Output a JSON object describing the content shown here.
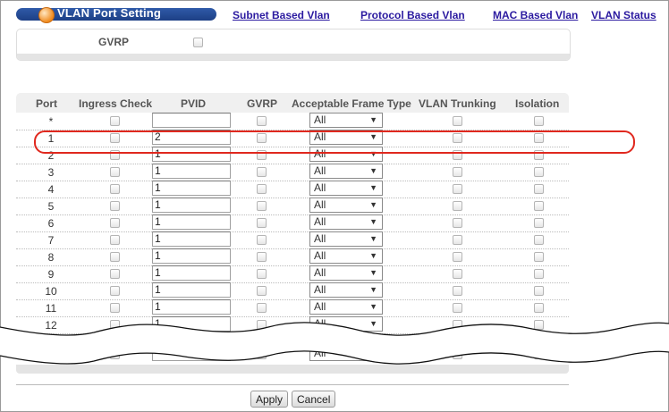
{
  "nav": {
    "title": "VLAN Port Setting",
    "links": [
      "Subnet Based Vlan",
      "Protocol Based Vlan",
      "MAC Based Vlan",
      "VLAN Status"
    ]
  },
  "gvrp_global": {
    "label": "GVRP"
  },
  "table": {
    "headers": [
      "Port",
      "Ingress Check",
      "PVID",
      "GVRP",
      "Acceptable Frame Type",
      "VLAN Trunking",
      "Isolation"
    ],
    "rows": [
      {
        "port": "*",
        "pvid": "",
        "frame": "All"
      },
      {
        "port": "1",
        "pvid": "2",
        "frame": "All"
      },
      {
        "port": "2",
        "pvid": "1",
        "frame": "All"
      },
      {
        "port": "3",
        "pvid": "1",
        "frame": "All"
      },
      {
        "port": "4",
        "pvid": "1",
        "frame": "All"
      },
      {
        "port": "5",
        "pvid": "1",
        "frame": "All"
      },
      {
        "port": "6",
        "pvid": "1",
        "frame": "All"
      },
      {
        "port": "7",
        "pvid": "1",
        "frame": "All"
      },
      {
        "port": "8",
        "pvid": "1",
        "frame": "All"
      },
      {
        "port": "9",
        "pvid": "1",
        "frame": "All"
      },
      {
        "port": "10",
        "pvid": "1",
        "frame": "All"
      },
      {
        "port": "11",
        "pvid": "1",
        "frame": "All"
      },
      {
        "port": "12",
        "pvid": "1",
        "frame": "All"
      }
    ],
    "last_row": {
      "frame": "All"
    }
  },
  "buttons": {
    "apply": "Apply",
    "cancel": "Cancel"
  },
  "colors": {
    "highlight": "#e0281e",
    "nav_link": "#2b1aa0",
    "title_bar": "#1d3f85"
  }
}
